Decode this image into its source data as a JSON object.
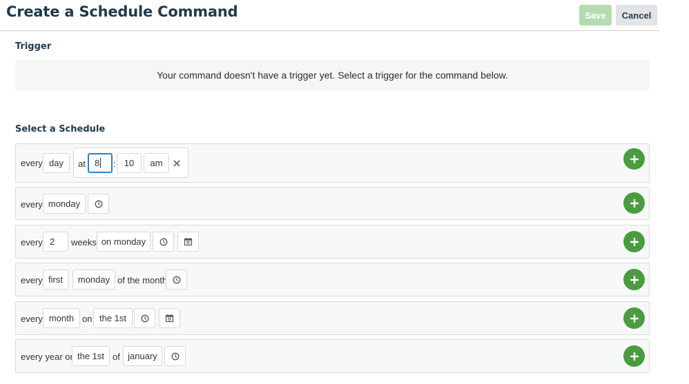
{
  "header": {
    "title": "Create a Schedule Command",
    "save_label": "Save",
    "cancel_label": "Cancel"
  },
  "trigger": {
    "title": "Trigger",
    "notice": "Your command doesn't have a trigger yet. Select a trigger for the command below."
  },
  "schedule": {
    "title": "Select a Schedule",
    "rows": [
      {
        "every": "every",
        "unit": "day",
        "at": "at",
        "hour": "8",
        "colon": ":",
        "minute": "10",
        "ampm": "am"
      },
      {
        "every": "every",
        "weekday": "monday"
      },
      {
        "every": "every",
        "count": "2",
        "weeks": "weeks",
        "weekday": "on monday"
      },
      {
        "every": "every",
        "ordinal": "first",
        "weekday": "monday",
        "suffix": "of the month"
      },
      {
        "every": "every",
        "unit": "month",
        "on": "on",
        "day": "the 1st"
      },
      {
        "every": "every year on",
        "day": "the 1st",
        "of": "of",
        "month": "january"
      }
    ]
  },
  "colors": {
    "title": "#1f3a4d",
    "add_button": "#4b9b3f",
    "save_disabled": "#b5dcb0",
    "focus": "#2f7fc7"
  }
}
